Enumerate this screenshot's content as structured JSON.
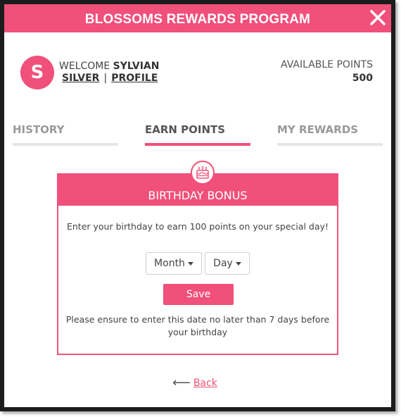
{
  "header": {
    "title": "BLOSSOMS REWARDS PROGRAM",
    "close_icon": "close-icon"
  },
  "profile": {
    "avatar_letter": "S",
    "welcome_prefix": "WELCOME",
    "name": "SYLVIAN",
    "tier": "SILVER",
    "separator": "|",
    "profile_link": "PROFILE"
  },
  "points": {
    "label": "AVAILABLE POINTS",
    "value": "500"
  },
  "tabs": [
    {
      "label": "HISTORY",
      "active": false
    },
    {
      "label": "EARN POINTS",
      "active": true
    },
    {
      "label": "MY REWARDS",
      "active": false
    }
  ],
  "card": {
    "icon": "birthday-cake-icon",
    "title": "BIRTHDAY BONUS",
    "description": "Enter your birthday to earn 100 points on your special day!",
    "month_select": "Month",
    "day_select": "Day",
    "save_label": "Save",
    "note": "Please ensure to enter this date no later than 7 days before your birthday"
  },
  "back": {
    "label": "Back",
    "icon": "left-arrow-icon"
  },
  "colors": {
    "accent": "#f0507a",
    "frame": "#1c1c1c",
    "inactive_tab": "#e6e6e6"
  }
}
